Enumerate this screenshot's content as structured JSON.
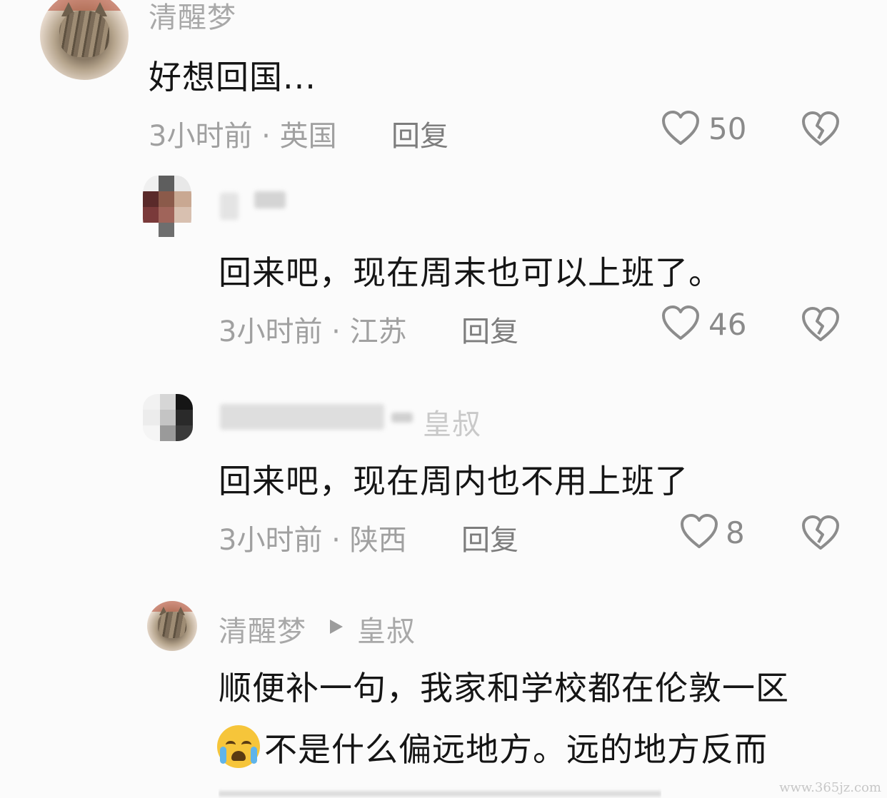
{
  "comments": [
    {
      "username": "清醒梦",
      "text": "好想回国...",
      "time_location": "3小时前 · 英国",
      "reply_label": "回复",
      "likes": "50"
    },
    {
      "username": "",
      "text": "回来吧，现在周末也可以上班了。",
      "time_location": "3小时前 · 江苏",
      "reply_label": "回复",
      "likes": "46"
    },
    {
      "username": "",
      "reply_to": "皇叔",
      "text": "回来吧，现在周内也不用上班了",
      "time_location": "3小时前 · 陕西",
      "reply_label": "回复",
      "likes": "8"
    },
    {
      "username": "清醒梦",
      "reply_to": "皇叔",
      "text_line1": "顺便补一句，我家和学校都在伦敦一区",
      "text_line2": "不是什么偏远地方。远的地方反而"
    }
  ],
  "icons": {
    "like": "heart-outline-icon",
    "dislike": "broken-heart-icon",
    "emoji": "loudly-crying-face-emoji",
    "reply_arrow": "play-triangle-icon"
  },
  "watermark": "www.365jz.com",
  "colors": {
    "text": "#151515",
    "meta": "#a0a0a0",
    "icon": "#8c8c8c"
  }
}
